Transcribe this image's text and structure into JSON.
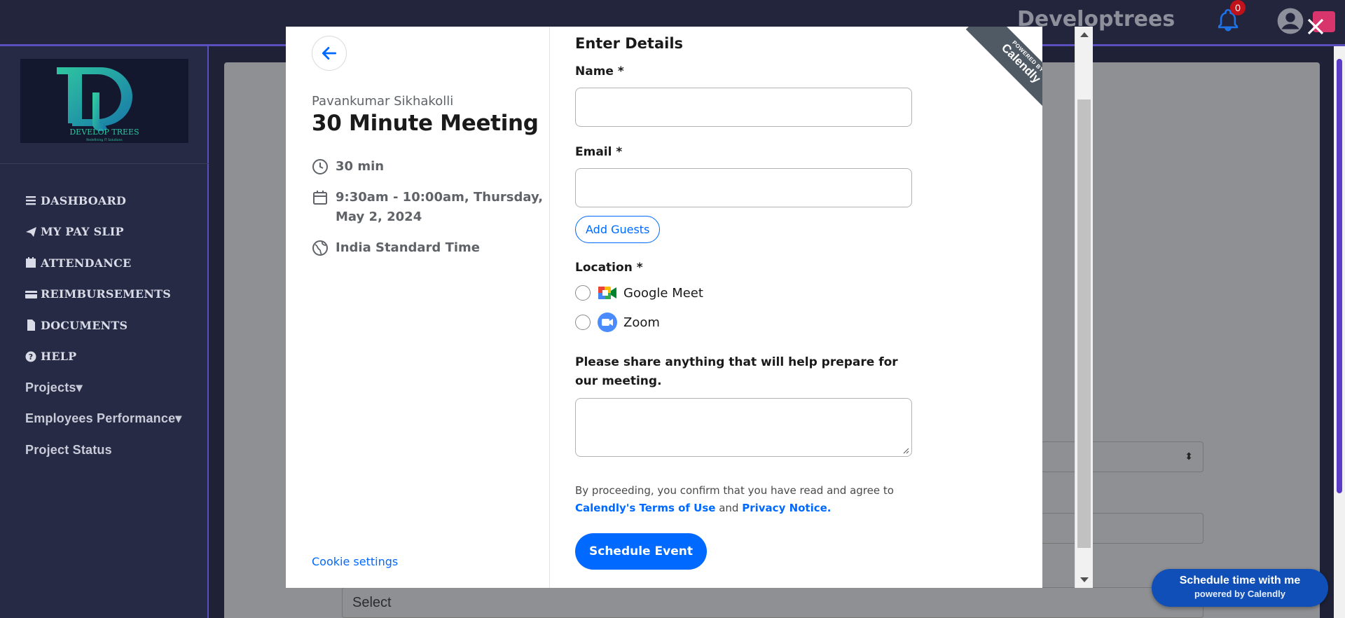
{
  "app": {
    "brand": "Developtrees",
    "notification_count": "0",
    "logo_text": "DEVELOP TREES",
    "logo_tagline": "Redefining IT Solutions"
  },
  "sidebar": {
    "items": [
      {
        "label": "DASHBOARD",
        "icon": "bars-icon"
      },
      {
        "label": "MY PAY SLIP",
        "icon": "paper-plane-icon"
      },
      {
        "label": "ATTENDANCE",
        "icon": "calendar-icon"
      },
      {
        "label": "REIMBURSEMENTS",
        "icon": "credit-card-icon"
      },
      {
        "label": "DOCUMENTS",
        "icon": "file-icon"
      },
      {
        "label": "HELP",
        "icon": "question-circle-icon"
      },
      {
        "label": "Projects▾",
        "icon": ""
      },
      {
        "label": "Employees Performance▾",
        "icon": ""
      },
      {
        "label": "Project Status",
        "icon": ""
      }
    ]
  },
  "background": {
    "select_placeholder": "Select"
  },
  "calendly_badge": {
    "line1": "Schedule time with me",
    "line2": "powered by Calendly"
  },
  "modal": {
    "host_name": "Pavankumar Sikhakolli",
    "event_title": "30 Minute Meeting",
    "duration": "30 min",
    "datetime_line1": "9:30am - 10:00am, Thursday,",
    "datetime_line2": "May 2, 2024",
    "timezone": "India Standard Time",
    "cookie_settings": "Cookie settings",
    "ribbon_small": "POWERED BY",
    "ribbon_brand": "Calendly",
    "form": {
      "heading": "Enter Details",
      "name_label": "Name *",
      "email_label": "Email *",
      "add_guests": "Add Guests",
      "location_label": "Location *",
      "location_options": [
        "Google Meet",
        "Zoom"
      ],
      "notes_label": "Please share anything that will help prepare for our meeting.",
      "legal_prefix": "By proceeding, you confirm that you have read and agree to",
      "terms_link": "Calendly's Terms of Use",
      "legal_and": "and",
      "privacy_link": "Privacy Notice.",
      "submit": "Schedule Event"
    }
  },
  "colors": {
    "accent": "#0069ff",
    "topbar": "#23253d",
    "sidebar": "#262a45",
    "badge": "#0f4fb7"
  }
}
